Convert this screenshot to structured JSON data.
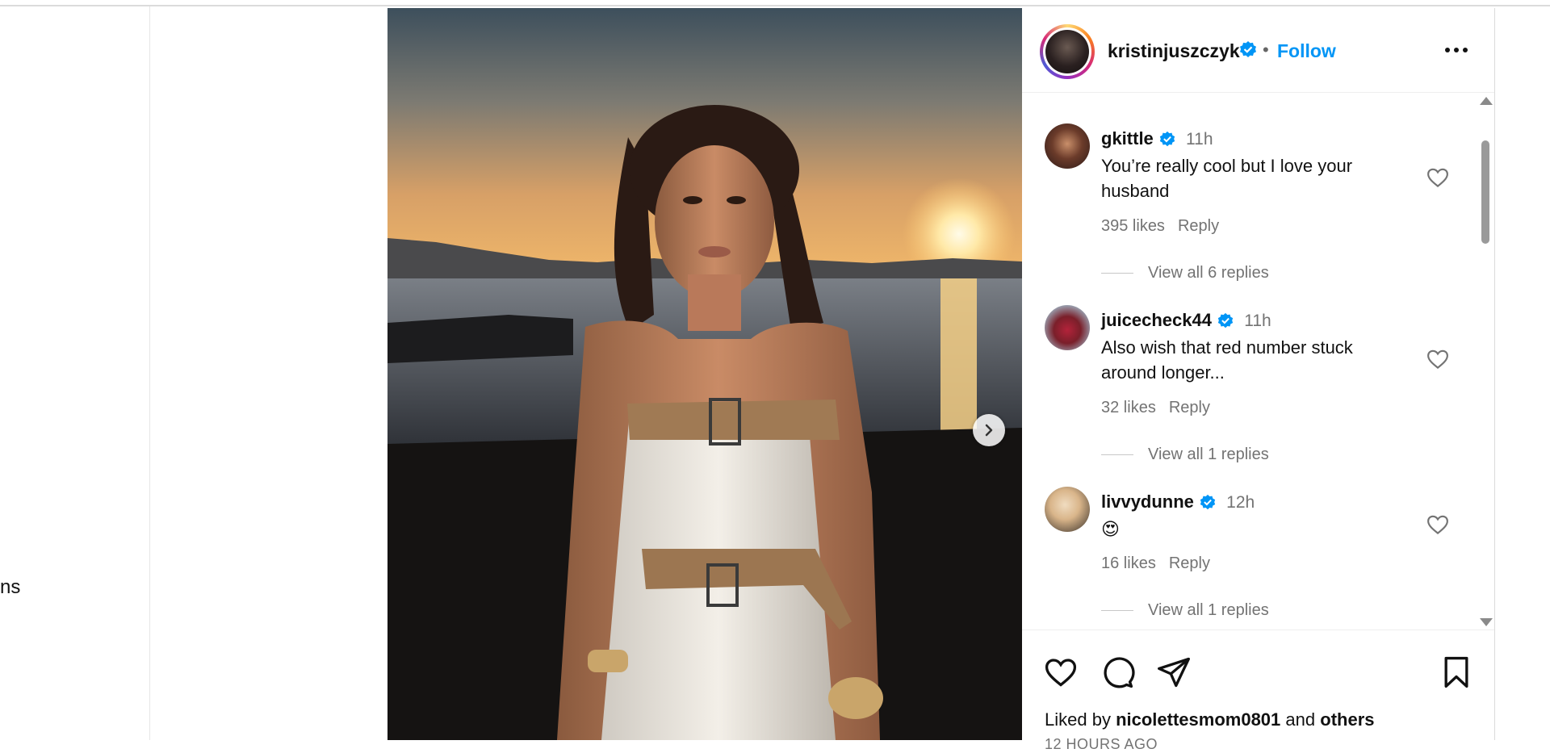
{
  "nav": {
    "partial_label": "ns"
  },
  "post": {
    "author": "kristinjuszczyk",
    "separator": "•",
    "follow_label": "Follow",
    "next_icon": "chevron-right-icon",
    "more_icon": "more-options-icon"
  },
  "comments": [
    {
      "user": "gkittle",
      "time": "11h",
      "text": "You’re really cool but I love your husband",
      "likes": "395 likes",
      "reply": "Reply",
      "view_replies": "View all 6 replies"
    },
    {
      "user": "juicecheck44",
      "time": "11h",
      "text": "Also wish that red number stuck around longer...",
      "likes": "32 likes",
      "reply": "Reply",
      "view_replies": "View all 1 replies"
    },
    {
      "user": "livvydunne",
      "time": "12h",
      "text": "😍",
      "likes": "16 likes",
      "reply": "Reply",
      "view_replies": "View all 1 replies"
    }
  ],
  "footer": {
    "liked_prefix": "Liked by",
    "liked_user": "nicolettesmom0801",
    "liked_and": "and",
    "liked_others": "others",
    "time_ago": "12 HOURS AGO"
  },
  "colors": {
    "accent": "#0095f6",
    "verified": "#0095f6",
    "muted": "#737373"
  }
}
